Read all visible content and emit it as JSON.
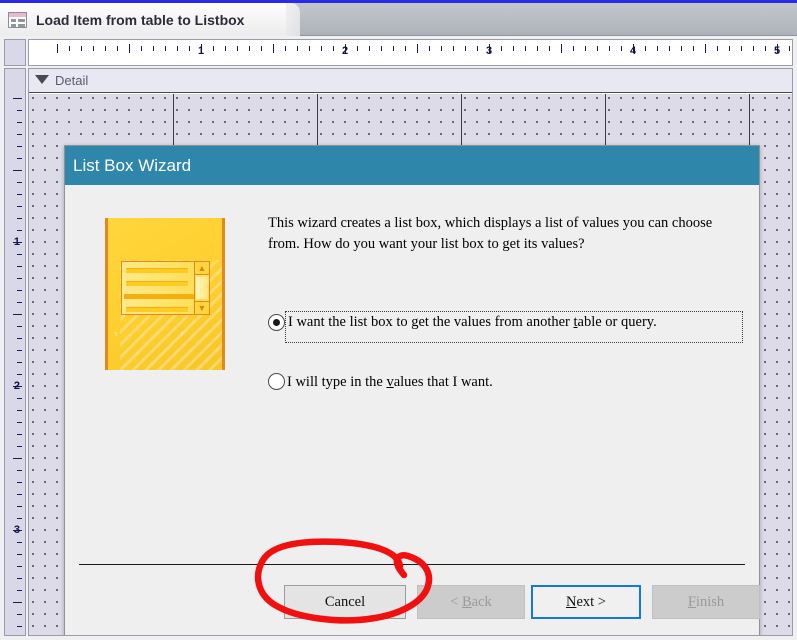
{
  "window": {
    "tab": {
      "title": "Load Item from table to Listbox",
      "icon": "form-design-icon"
    }
  },
  "ruler": {
    "horizontal_labels": [
      "1",
      "2",
      "3",
      "4",
      "5"
    ],
    "vertical_labels": [
      "1",
      "2",
      "3"
    ]
  },
  "design_surface": {
    "section_label": "Detail",
    "section_collapse_icon": "collapse-arrow-icon"
  },
  "wizard": {
    "title": "List Box Wizard",
    "accent_color": "#2e86ab",
    "prompt": "This wizard creates a list box, which displays a list of values you can choose from.  How do you want your list box to get its values?",
    "illustration": {
      "icon": "listbox-illustration",
      "scrollbar_up_icon": "chevron-up-icon",
      "scrollbar_down_icon": "chevron-down-icon"
    },
    "options": [
      {
        "id": "from-table-or-query",
        "label_before": "I want the list box to get the values from another ",
        "accel": "t",
        "label_after": "able or query.",
        "selected": true,
        "focused": true
      },
      {
        "id": "type-in-values",
        "label_before": "I will type in the ",
        "accel": "v",
        "label_after": "alues that I want.",
        "selected": false,
        "focused": false
      }
    ],
    "buttons": [
      {
        "id": "cancel",
        "label_before": "Cancel",
        "accel": "",
        "label_after": "",
        "state": "enabled",
        "default": false
      },
      {
        "id": "back",
        "label_before": "< ",
        "accel": "B",
        "label_after": "ack",
        "state": "disabled",
        "default": false
      },
      {
        "id": "next",
        "label_before": "",
        "accel": "N",
        "label_after": "ext >",
        "state": "enabled",
        "default": true
      },
      {
        "id": "finish",
        "label_before": "",
        "accel": "F",
        "label_after": "inish",
        "state": "disabled",
        "default": false
      }
    ]
  },
  "annotation": {
    "type": "hand-drawn-ellipse",
    "color": "#f01010",
    "target": "cancel-button"
  }
}
